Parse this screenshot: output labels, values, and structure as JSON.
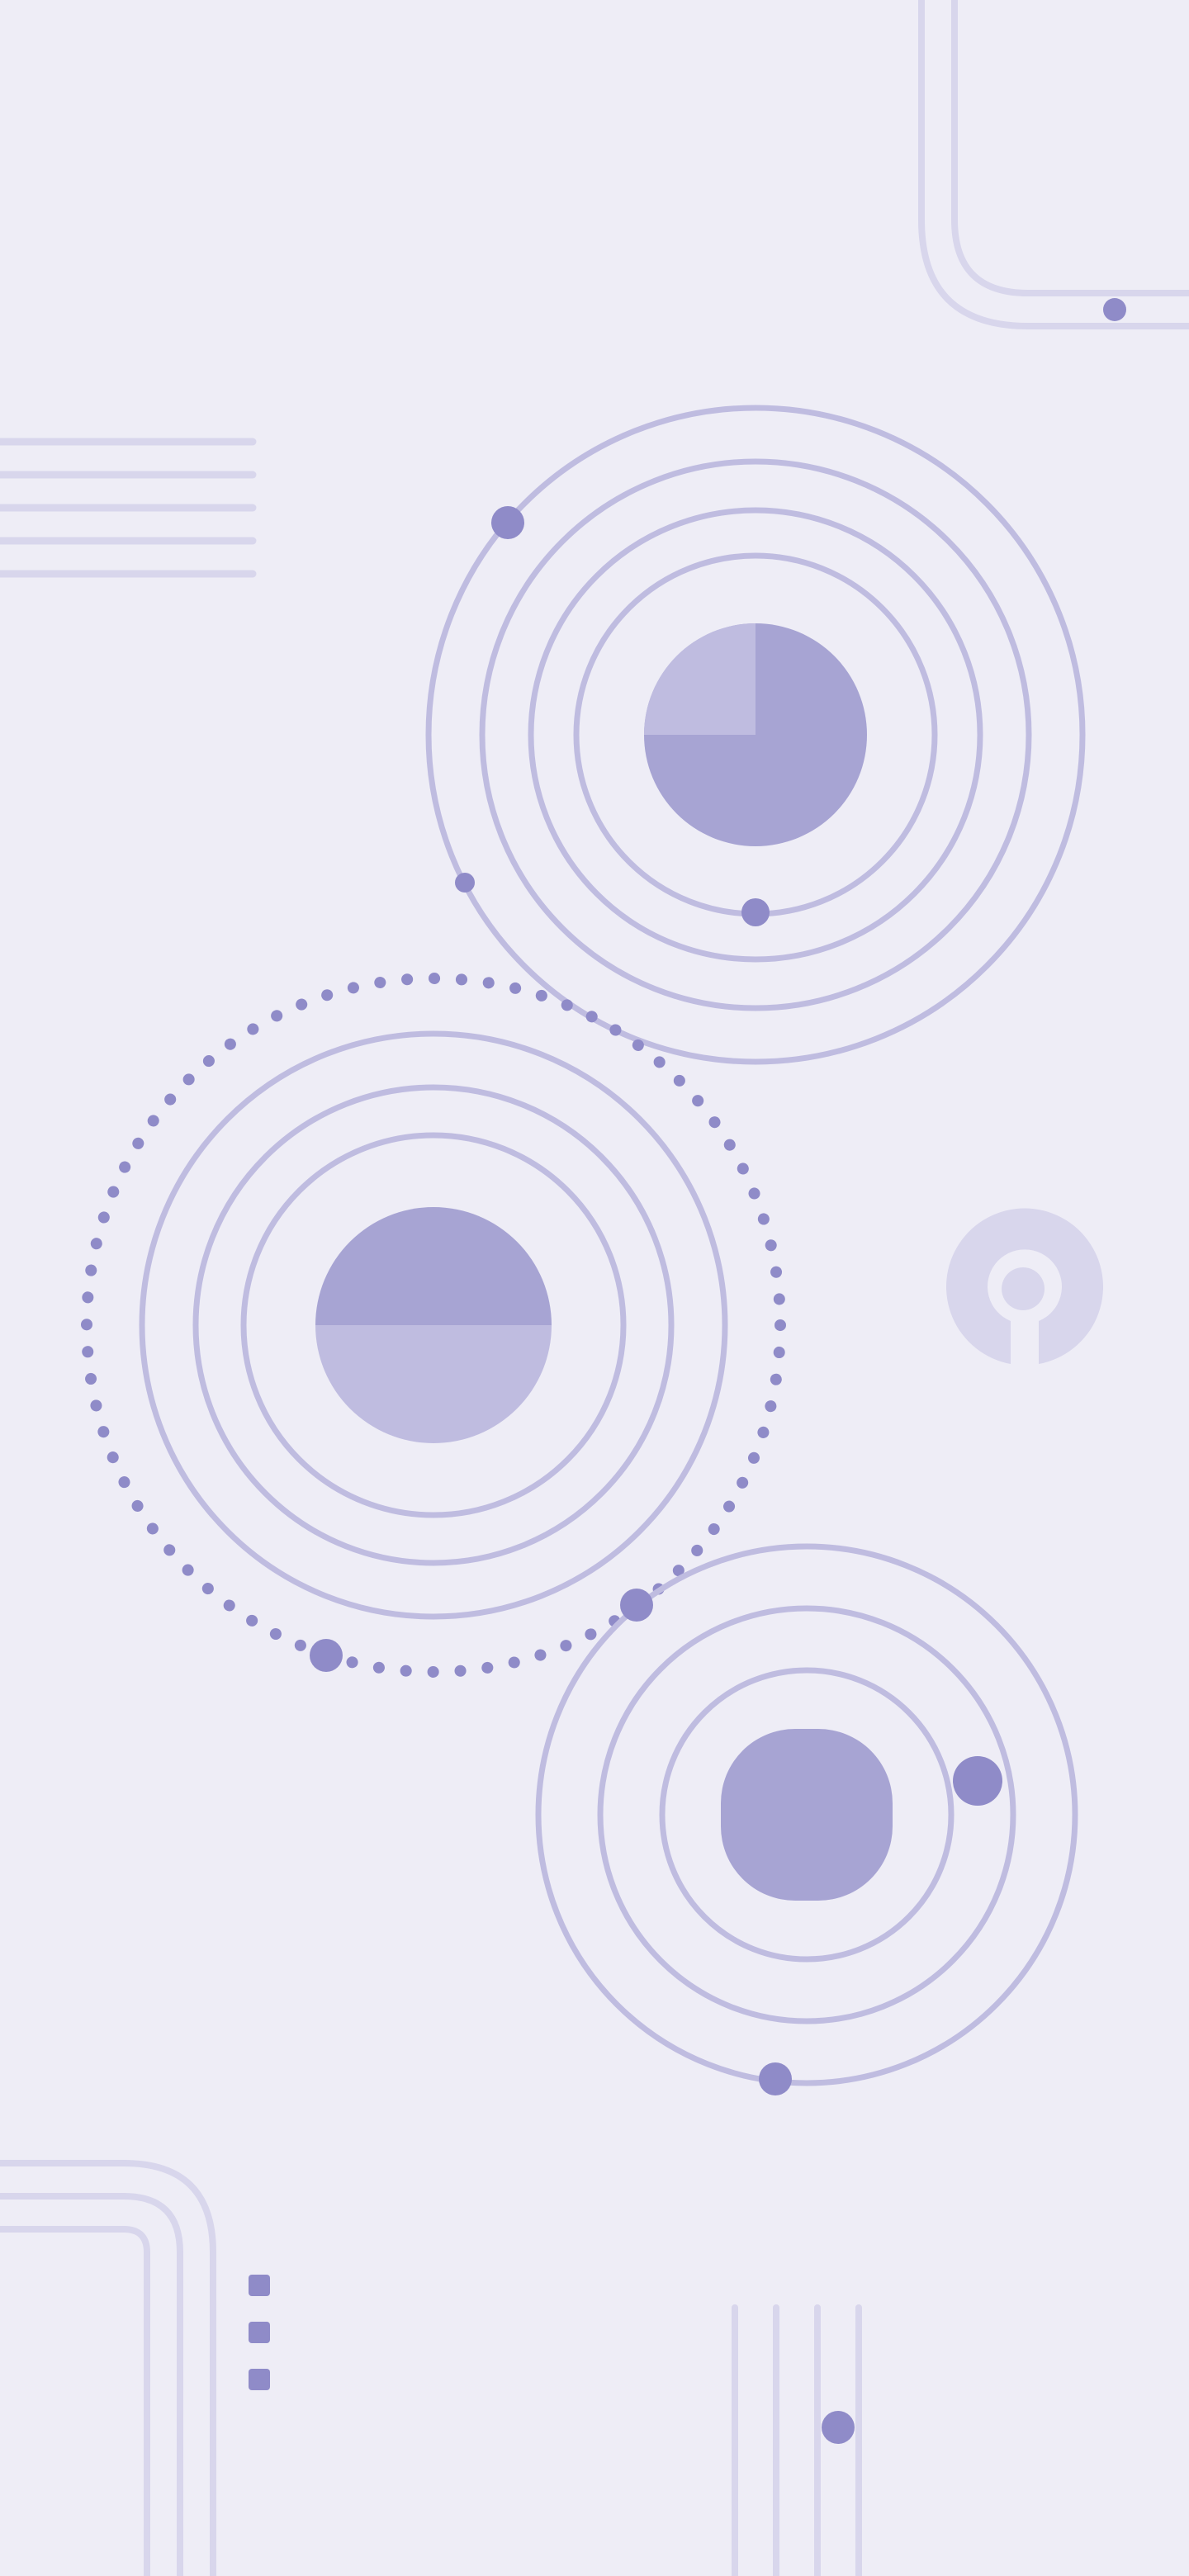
{
  "colors": {
    "background": "#EEEDF6",
    "line_light": "#D8D6EC",
    "ring": "#BFBCE0",
    "fill_dark": "#A7A4D3",
    "fill_light": "#BFBCE0",
    "dot": "#8F8BC8",
    "keyhole": "#D8D6EC"
  },
  "icons": {
    "keyhole": "keyhole-icon"
  }
}
